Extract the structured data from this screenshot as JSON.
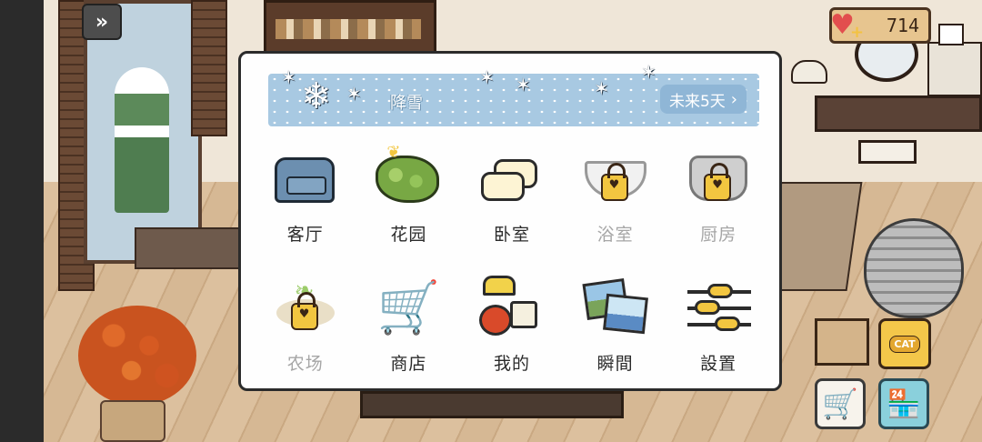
{
  "hud": {
    "back_icon": "»",
    "hearts_count": "714",
    "cat_bowl_label": "CAT"
  },
  "weather": {
    "condition": "降雪",
    "forecast_label": "未来5天",
    "forecast_chevron": "›"
  },
  "menu": {
    "items": [
      {
        "label": "客厅",
        "icon": "sofa-icon",
        "locked": false
      },
      {
        "label": "花园",
        "icon": "bush-icon",
        "locked": false
      },
      {
        "label": "卧室",
        "icon": "pillows-icon",
        "locked": false
      },
      {
        "label": "浴室",
        "icon": "bathtub-icon",
        "locked": true
      },
      {
        "label": "厨房",
        "icon": "cooking-pot-icon",
        "locked": true
      },
      {
        "label": "农场",
        "icon": "sprout-icon",
        "locked": true
      },
      {
        "label": "商店",
        "icon": "shopping-cart-icon",
        "locked": false
      },
      {
        "label": "我的",
        "icon": "lamp-apple-mug-icon",
        "locked": false
      },
      {
        "label": "瞬間",
        "icon": "photos-icon",
        "locked": false
      },
      {
        "label": "設置",
        "icon": "sliders-icon",
        "locked": false
      }
    ]
  },
  "colors": {
    "weather_banner": "#a8c9e2",
    "locked_label": "#a6a6a6",
    "lock": "#f2c640"
  }
}
